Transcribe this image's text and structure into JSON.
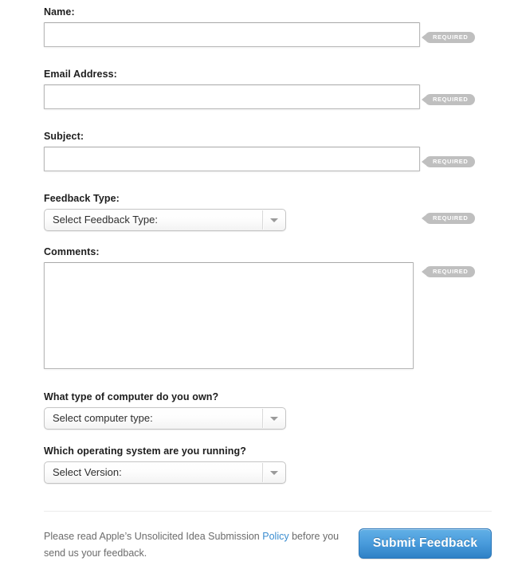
{
  "form": {
    "fields": [
      {
        "label": "Name:",
        "type": "text",
        "value": "",
        "placeholder": "",
        "required_badge": "REQUIRED"
      },
      {
        "label": "Email Address:",
        "type": "text",
        "value": "",
        "placeholder": "",
        "required_badge": "REQUIRED"
      },
      {
        "label": "Subject:",
        "type": "text",
        "value": "",
        "placeholder": "",
        "required_badge": "REQUIRED"
      },
      {
        "label": "Feedback Type:",
        "type": "select",
        "value": "Select Feedback Type:",
        "required_badge": "REQUIRED"
      },
      {
        "label": "Comments:",
        "type": "textarea",
        "value": "",
        "placeholder": "",
        "required_badge": "REQUIRED"
      },
      {
        "label": "What type of computer do you own?",
        "type": "select",
        "value": "Select computer type:",
        "required_badge": ""
      },
      {
        "label": "Which operating system are you running?",
        "type": "select",
        "value": "Select Version:",
        "required_badge": ""
      }
    ]
  },
  "footer": {
    "note_before_link": "Please read Apple’s Unsolicited Idea Submission ",
    "link_text": "Policy",
    "note_after_link": " before you send us your feedback.",
    "submit_label": "Submit Feedback",
    "link_color": "#3b8dd0",
    "button_color": "#4b9ddd"
  }
}
